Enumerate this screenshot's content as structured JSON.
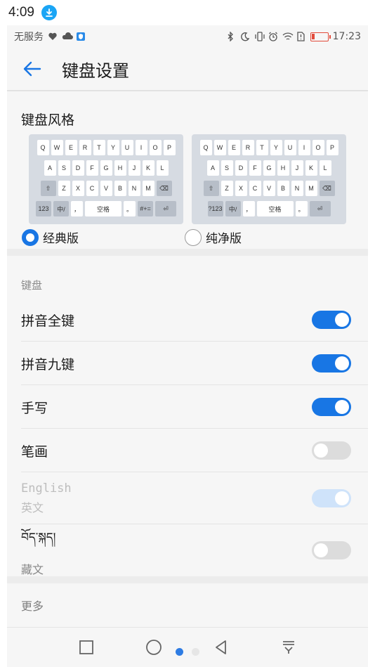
{
  "outer_status": {
    "time": "4:09",
    "download_icon": "download-icon"
  },
  "status_bar": {
    "carrier": "无服务",
    "time": "17:23",
    "icons_left": [
      "heart-icon",
      "cloud-icon",
      "shield-app-icon"
    ],
    "icons_right": [
      "bluetooth-icon",
      "moon-icon",
      "vibrate-icon",
      "alarm-icon",
      "wifi-icon",
      "sim-alert-icon",
      "battery-icon"
    ],
    "battery_level": 0.2,
    "battery_color": "#e24b3b"
  },
  "header": {
    "title": "键盘设置"
  },
  "keyboard_style": {
    "title": "键盘风格",
    "options": [
      {
        "label": "经典版",
        "selected": true,
        "row1": [
          "Q",
          "W",
          "E",
          "R",
          "T",
          "Y",
          "U",
          "I",
          "O",
          "P"
        ],
        "row2": [
          "A",
          "S",
          "D",
          "F",
          "G",
          "H",
          "J",
          "K",
          "L"
        ],
        "row3": [
          "Z",
          "X",
          "C",
          "V",
          "B",
          "N",
          "M"
        ],
        "bottom": [
          "123",
          "中/",
          "，",
          "空格",
          "。",
          "#+="
        ]
      },
      {
        "label": "纯净版",
        "selected": false,
        "row1": [
          "Q",
          "W",
          "E",
          "R",
          "T",
          "Y",
          "U",
          "I",
          "O",
          "P"
        ],
        "row2": [
          "A",
          "S",
          "D",
          "F",
          "G",
          "H",
          "J",
          "K",
          "L"
        ],
        "row3": [
          "Z",
          "X",
          "C",
          "V",
          "B",
          "N",
          "M"
        ],
        "bottom": [
          "?123",
          "中/",
          "，",
          "空格",
          "。"
        ]
      }
    ]
  },
  "keyboards": {
    "header": "键盘",
    "items": [
      {
        "label": "拼音全键",
        "enabled": true
      },
      {
        "label": "拼音九键",
        "enabled": true
      },
      {
        "label": "手写",
        "enabled": true
      },
      {
        "label": "笔画",
        "enabled": false
      },
      {
        "label": "English",
        "sublabel": "英文",
        "enabled": true,
        "disabled": true
      },
      {
        "label": "བོད་སྐད།",
        "sublabel": "藏文",
        "enabled": false
      }
    ]
  },
  "more": {
    "header": "更多"
  },
  "nav": {
    "buttons": [
      "recent-apps-icon",
      "home-icon",
      "back-icon",
      "notification-pull-icon"
    ],
    "page_dots": 2,
    "active_dot": 0
  },
  "colors": {
    "accent": "#1876e4"
  }
}
